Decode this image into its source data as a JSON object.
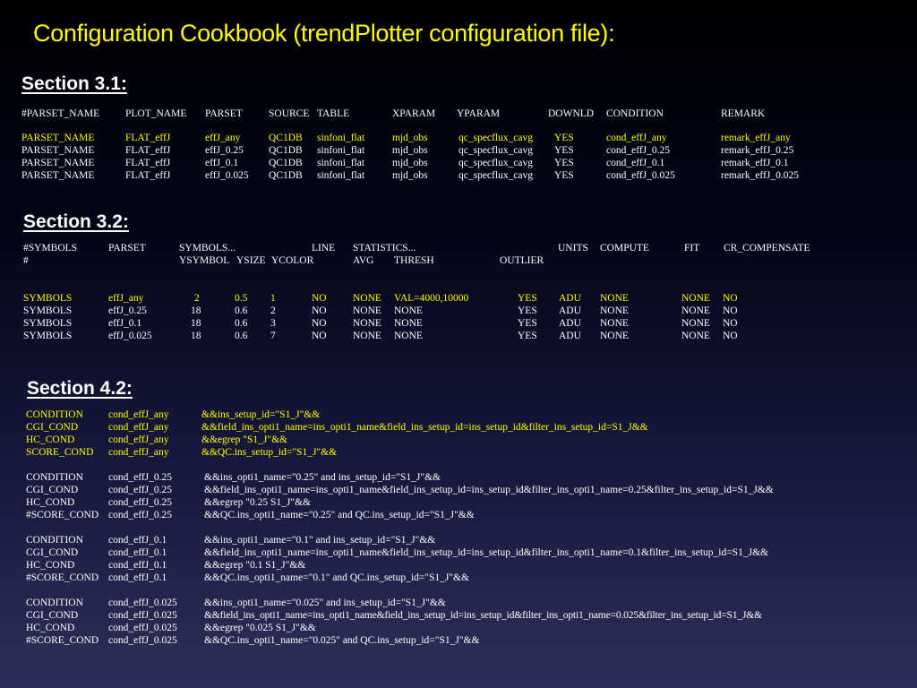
{
  "title": "Configuration Cookbook (trendPlotter configuration file):",
  "section31": {
    "heading": "Section 3.1:",
    "header": [
      "#PARSET_NAME",
      "PLOT_NAME",
      "PARSET",
      "SOURCE",
      "TABLE",
      "XPARAM",
      "YPARAM",
      "DOWNLD",
      "CONDITION",
      "REMARK"
    ],
    "rows": [
      [
        "PARSET_NAME",
        "FLAT_effJ",
        "effJ_any",
        "QC1DB",
        "sinfoni_flat",
        "mjd_obs",
        "qc_specflux_cavg",
        "YES",
        "cond_effJ_any",
        "remark_effJ_any"
      ],
      [
        "PARSET_NAME",
        "FLAT_effJ",
        "effJ_0.25",
        "QC1DB",
        "sinfoni_flat",
        "mjd_obs",
        "qc_specflux_cavg",
        "YES",
        "cond_effJ_0.25",
        "remark_effJ_0.25"
      ],
      [
        "PARSET_NAME",
        "FLAT_effJ",
        "effJ_0.1",
        "QC1DB",
        "sinfoni_flat",
        "mjd_obs",
        "qc_specflux_cavg",
        "YES",
        "cond_effJ_0.1",
        "remark_effJ_0.1"
      ],
      [
        "PARSET_NAME",
        "FLAT_effJ",
        "effJ_0.025",
        "QC1DB",
        "sinfoni_flat",
        "mjd_obs",
        "qc_specflux_cavg",
        "YES",
        "cond_effJ_0.025",
        "remark_effJ_0.025"
      ]
    ]
  },
  "section32": {
    "heading": "Section 3.2:",
    "header1": [
      "#SYMBOLS",
      "PARSET",
      "SYMBOLS...",
      "LINE",
      "STATISTICS...",
      "UNITS",
      "COMPUTE",
      "FIT",
      "CR_COMPENSATE"
    ],
    "header2": [
      "#",
      "YSYMBOL",
      "YSIZE",
      "YCOLOR",
      "AVG",
      "THRESH",
      "OUTLIER"
    ],
    "rows": [
      [
        "SYMBOLS",
        "effJ_any",
        "2",
        "0.5",
        "1",
        "NO",
        "NONE",
        "VAL=4000,10000",
        "YES",
        "ADU",
        "NONE",
        "NONE",
        "NO"
      ],
      [
        "SYMBOLS",
        "effJ_0.25",
        "18",
        "0.6",
        "2",
        "NO",
        "NONE",
        "NONE",
        "YES",
        "ADU",
        "NONE",
        "NONE",
        "NO"
      ],
      [
        "SYMBOLS",
        "effJ_0.1",
        "18",
        "0.6",
        "3",
        "NO",
        "NONE",
        "NONE",
        "YES",
        "ADU",
        "NONE",
        "NONE",
        "NO"
      ],
      [
        "SYMBOLS",
        "effJ_0.025",
        "18",
        "0.6",
        "7",
        "NO",
        "NONE",
        "NONE",
        "YES",
        "ADU",
        "NONE",
        "NONE",
        "NO"
      ]
    ]
  },
  "section42": {
    "heading": "Section 4.2:",
    "groups": [
      [
        [
          "CONDITION",
          "cond_effJ_any",
          "&&ins_setup_id=\"S1_J\"&&"
        ],
        [
          "CGI_COND",
          "cond_effJ_any",
          "&&field_ins_opti1_name=ins_opti1_name&field_ins_setup_id=ins_setup_id&filter_ins_setup_id=S1_J&&"
        ],
        [
          "HC_COND",
          "cond_effJ_any",
          "&&egrep \"S1_J\"&&"
        ],
        [
          "SCORE_COND",
          "cond_effJ_any",
          "&&QC.ins_setup_id=\"S1_J\"&&"
        ]
      ],
      [
        [
          "CONDITION",
          "cond_effJ_0.25",
          "&&ins_opti1_name=\"0.25\" and ins_setup_id=\"S1_J\"&&"
        ],
        [
          "CGI_COND",
          "cond_effJ_0.25",
          "&&field_ins_opti1_name=ins_opti1_name&field_ins_setup_id=ins_setup_id&filter_ins_opti1_name=0.25&filter_ins_setup_id=S1_J&&"
        ],
        [
          "HC_COND",
          "cond_effJ_0.25",
          "&&egrep \"0.25 S1_J\"&&"
        ],
        [
          "#SCORE_COND",
          "cond_effJ_0.25",
          "&&QC.ins_opti1_name=\"0.25\" and QC.ins_setup_id=\"S1_J\"&&"
        ]
      ],
      [
        [
          "CONDITION",
          "cond_effJ_0.1",
          "&&ins_opti1_name=\"0.1\" and ins_setup_id=\"S1_J\"&&"
        ],
        [
          "CGI_COND",
          "cond_effJ_0.1",
          "&&field_ins_opti1_name=ins_opti1_name&field_ins_setup_id=ins_setup_id&filter_ins_opti1_name=0.1&filter_ins_setup_id=S1_J&&"
        ],
        [
          "HC_COND",
          "cond_effJ_0.1",
          "&&egrep \"0.1 S1_J\"&&"
        ],
        [
          "#SCORE_COND",
          "cond_effJ_0.1",
          "&&QC.ins_opti1_name=\"0.1\" and QC.ins_setup_id=\"S1_J\"&&"
        ]
      ],
      [
        [
          "CONDITION",
          "cond_effJ_0.025",
          "&&ins_opti1_name=\"0.025\" and ins_setup_id=\"S1_J\"&&"
        ],
        [
          "CGI_COND",
          "cond_effJ_0.025",
          "&&field_ins_opti1_name=ins_opti1_name&field_ins_setup_id=ins_setup_id&filter_ins_opti1_name=0.025&filter_ins_setup_id=S1_J&&"
        ],
        [
          "HC_COND",
          "cond_effJ_0.025",
          "&&egrep \"0.025 S1_J\"&&"
        ],
        [
          "#SCORE_COND",
          "cond_effJ_0.025",
          "&&QC.ins_opti1_name=\"0.025\" and QC.ins_setup_id=\"S1_J\"&&"
        ]
      ]
    ]
  },
  "colors": {
    "title": "#ffff00",
    "highlight_row": "#ffff00",
    "text": "#ffffff"
  }
}
